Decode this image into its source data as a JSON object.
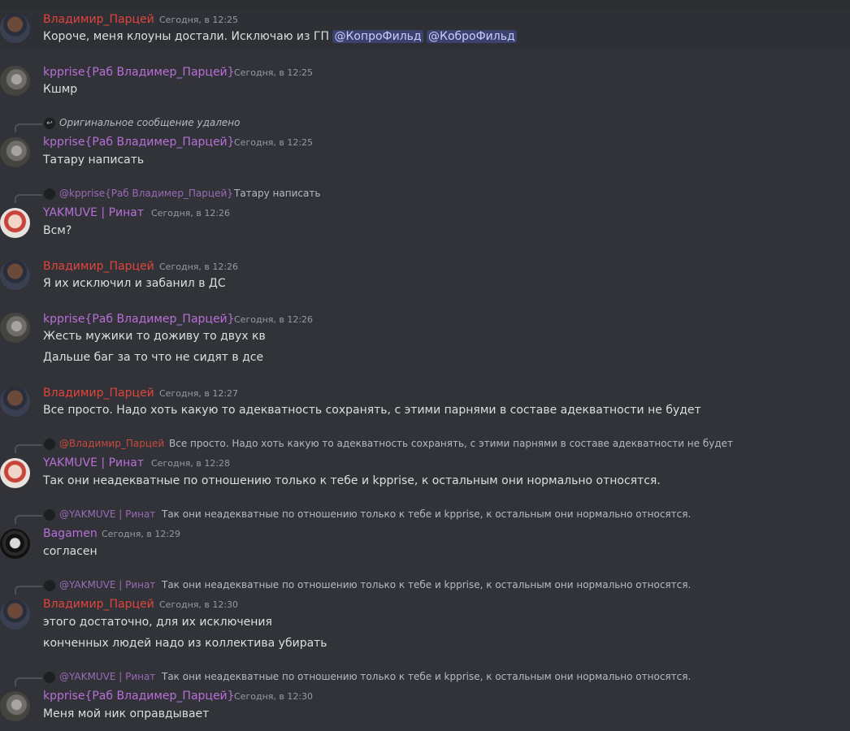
{
  "messages": [
    {
      "author": "Владимир_Парцей",
      "timestamp": "Сегодня, в 12:25",
      "text_prefix": "Короче, меня клоуны достали. Исключаю из ГП",
      "mentions": [
        "@КопроФильд",
        "@КоброФильд"
      ]
    },
    {
      "author": "kpprise{Раб Владимер_Парцей}",
      "timestamp": "Сегодня, в 12:25",
      "text": "Кшмр"
    },
    {
      "reply": {
        "text": "Оригинальное сообщение удалено"
      },
      "author": "kpprise{Раб Владимер_Парцей}",
      "timestamp": "Сегодня, в 12:25",
      "text": "Татару написать"
    },
    {
      "reply": {
        "name": "@kpprise{Раб Владимер_Парцей}",
        "text": "Татару написать"
      },
      "author": "YAKMUVE | Ринат",
      "timestamp": "Сегодня, в 12:26",
      "text": "Всм?"
    },
    {
      "author": "Владимир_Парцей",
      "timestamp": "Сегодня, в 12:26",
      "text": "Я их исключил и забанил в ДС"
    },
    {
      "author": "kpprise{Раб Владимер_Парцей}",
      "timestamp": "Сегодня, в 12:26",
      "lines": [
        "Жесть мужики то доживу то двух кв",
        "Дальше баг за то что не сидят в дсе"
      ]
    },
    {
      "author": "Владимир_Парцей",
      "timestamp": "Сегодня, в 12:27",
      "text": "Все просто. Надо хоть какую то адекватность сохранять, с этими парнями в составе адекватности не будет"
    },
    {
      "reply": {
        "name": "@Владимир_Парцей",
        "text": "Все просто. Надо хоть какую то адекватность сохранять, с этими парнями в составе адекватности не будет"
      },
      "author": "YAKMUVE | Ринат",
      "timestamp": "Сегодня, в 12:28",
      "text": "Так они неадекватные по отношению только к тебе и kpprise, к остальным они нормально относятся."
    },
    {
      "reply": {
        "name": "@YAKMUVE | Ринат",
        "text": "Так они неадекватные по отношению только к тебе и kpprise, к остальным они нормально относятся."
      },
      "author": "Bagamen",
      "timestamp": "Сегодня, в 12:29",
      "text": "согласен"
    },
    {
      "reply": {
        "name": "@YAKMUVE | Ринат",
        "text": "Так они неадекватные по отношению только к тебе и kpprise, к остальным они нормально относятся."
      },
      "author": "Владимир_Парцей",
      "timestamp": "Сегодня, в 12:30",
      "lines": [
        "этого достаточно, для их исключения",
        "конченных людей надо из коллектива убирать"
      ]
    },
    {
      "reply": {
        "name": "@YAKMUVE | Ринат",
        "text": "Так они неадекватные по отношению только к тебе и kpprise, к остальным они нормально относятся."
      },
      "author": "kpprise{Раб Владимер_Парцей}",
      "timestamp": "Сегодня, в 12:30",
      "text": "Меня мой ник оправдывает"
    }
  ],
  "colors": {
    "background": "#313338",
    "author_red": "#e2443d",
    "author_purple": "#b86fd8",
    "mention_bg": "#3c4270",
    "timestamp": "#949ba4"
  },
  "icons": {
    "reply": "reply-arrow-icon"
  }
}
